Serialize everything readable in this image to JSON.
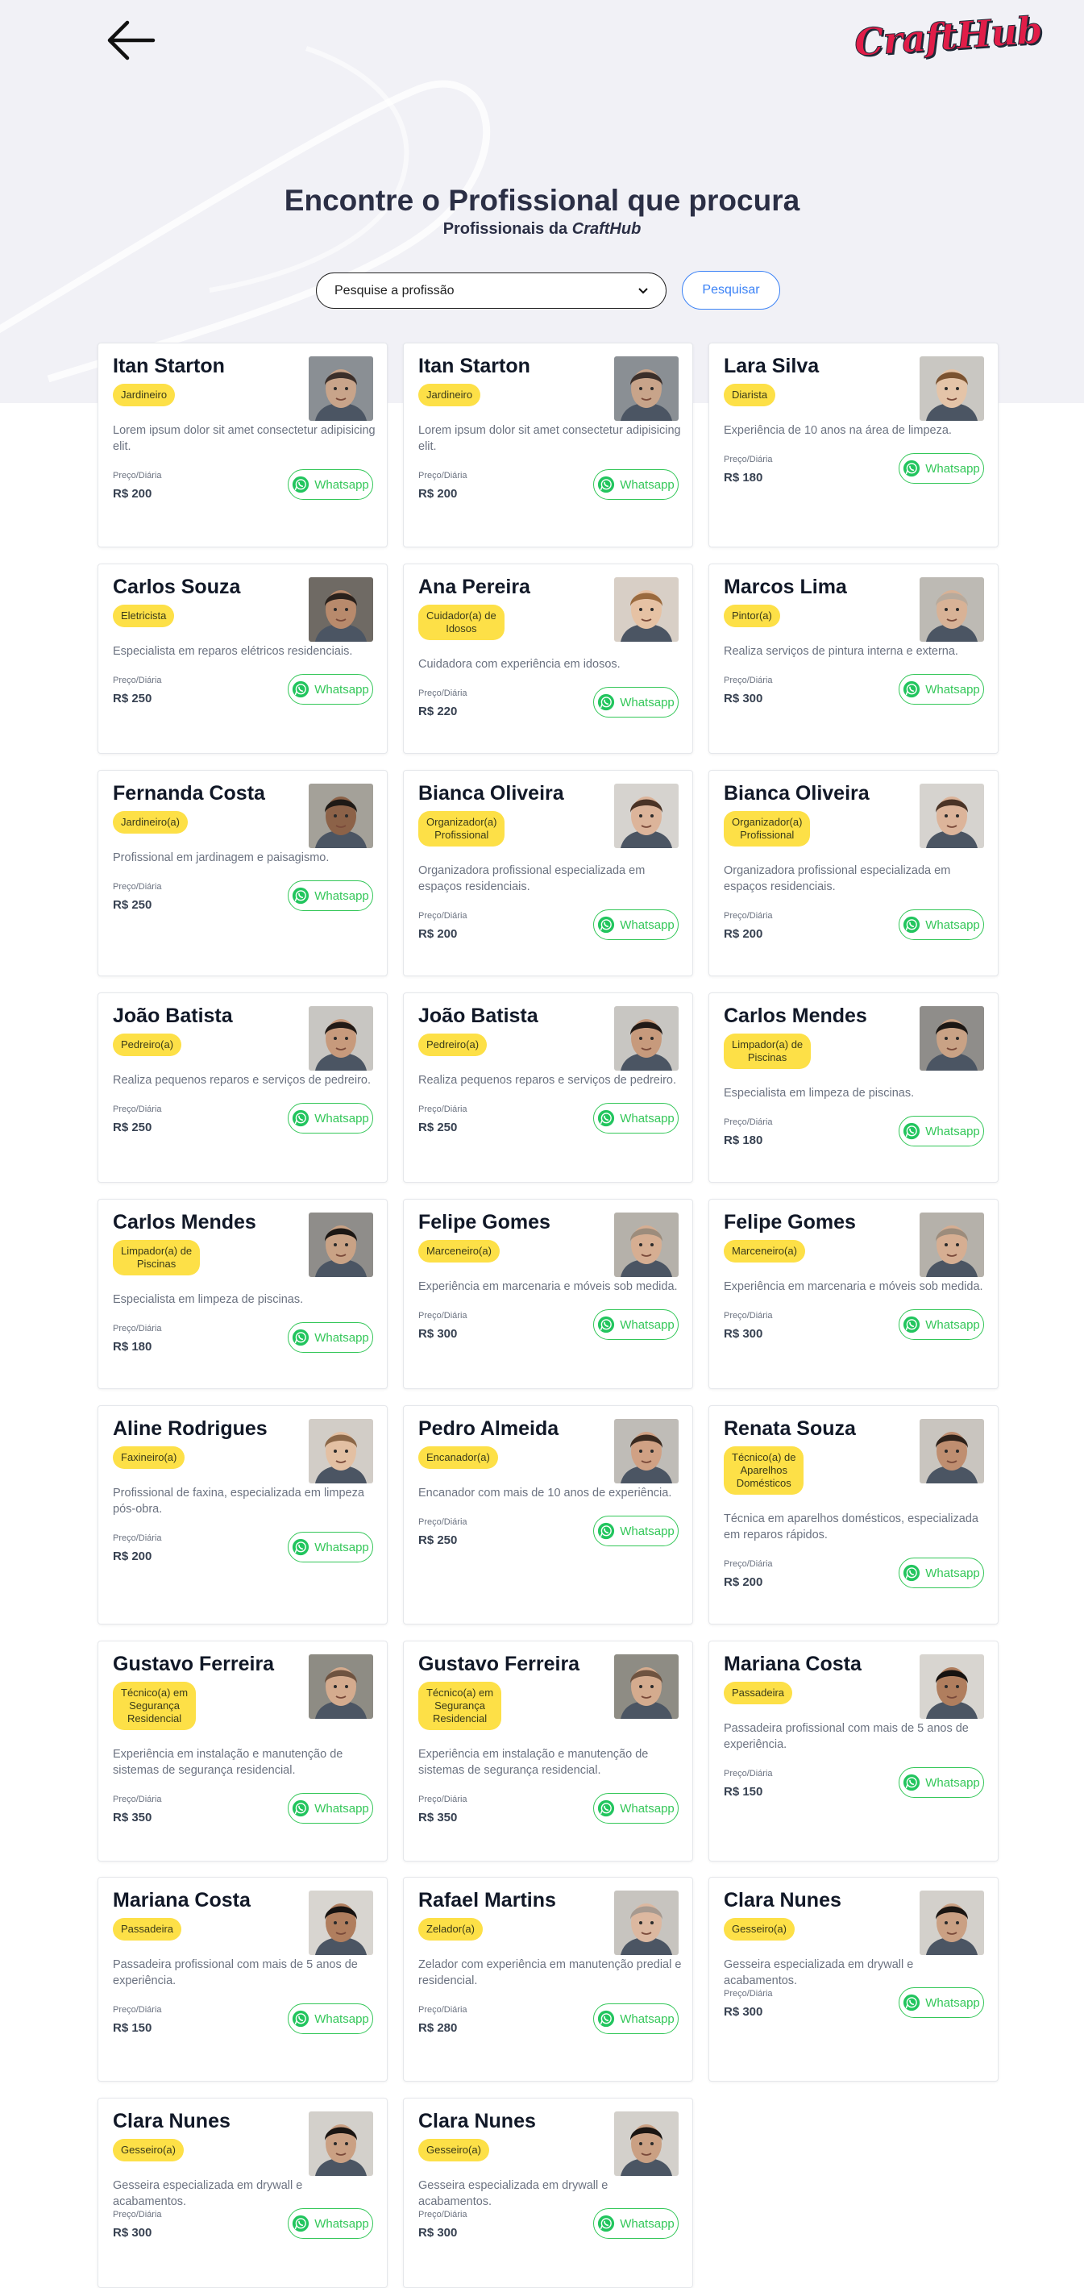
{
  "header": {
    "back_icon": "arrow-left-icon",
    "logo_text": "CraftHub",
    "title": "Encontre o Profissional que procura",
    "subtitle_prefix": "Profissionais da ",
    "subtitle_brand": "CraftHub"
  },
  "search": {
    "selected": "Pesquise a profissão",
    "button_label": "Pesquisar"
  },
  "colors": {
    "hero_bg": "#f1f1f6",
    "badge": "#fde047",
    "whatsapp": "#34c759",
    "accent_blue": "#3b82f6",
    "logo_red": "#e11d48"
  },
  "card_labels": {
    "price_label": "Preço/Diária",
    "whatsapp_label": "Whatsapp"
  },
  "cards": [
    {
      "name": "Itan Starton",
      "badge": [
        "Jardineiro"
      ],
      "desc": [
        "Lorem ipsum dolor sit amet consectetur adipisicing",
        "elit."
      ],
      "price": "R$ 200",
      "skin": "#c8a48a",
      "hair": "#3b2f2a",
      "bg": "#8a8f94"
    },
    {
      "name": "Itan Starton",
      "badge": [
        "Jardineiro"
      ],
      "desc": [
        "Lorem ipsum dolor sit amet consectetur adipisicing",
        "elit."
      ],
      "price": "R$ 200",
      "skin": "#c8a48a",
      "hair": "#3b2f2a",
      "bg": "#8a8f94"
    },
    {
      "name": "Lara Silva",
      "badge": [
        "Diarista"
      ],
      "desc": [
        "Experiência de 10 anos na área de limpeza."
      ],
      "price": "R$ 180",
      "skin": "#e4c4a8",
      "hair": "#7a5230",
      "bg": "#c9c7c2"
    },
    {
      "name": "Carlos Souza",
      "badge": [
        "Eletricista"
      ],
      "desc": [
        "Especialista em reparos elétricos residenciais."
      ],
      "price": "R$ 250",
      "skin": "#b88a6c",
      "hair": "#2a211c",
      "bg": "#6f6a64"
    },
    {
      "name": "Ana Pereira",
      "badge": [
        "Cuidador(a) de",
        "Idosos"
      ],
      "desc": [
        "Cuidadora com experiência em idosos."
      ],
      "price": "R$ 220",
      "skin": "#e6c2a4",
      "hair": "#9a6a3e",
      "bg": "#d8cfc6"
    },
    {
      "name": "Marcos Lima",
      "badge": [
        "Pintor(a)"
      ],
      "desc": [
        "Realiza serviços de pintura interna e externa."
      ],
      "price": "R$ 300",
      "skin": "#d8b296",
      "hair": "#b8aa9c",
      "bg": "#bdbab4"
    },
    {
      "name": "Fernanda Costa",
      "badge": [
        "Jardineiro(a)"
      ],
      "desc": [
        "Profissional em jardinagem e paisagismo."
      ],
      "price": "R$ 250",
      "skin": "#8c6248",
      "hair": "#1f1a16",
      "bg": "#a4a199"
    },
    {
      "name": "Bianca Oliveira",
      "badge": [
        "Organizador(a)",
        "Profissional"
      ],
      "desc": [
        "Organizadora profissional especializada em",
        "espaços residenciais."
      ],
      "price": "R$ 200",
      "skin": "#dcb49a",
      "hair": "#4a3326",
      "bg": "#d6d3cf"
    },
    {
      "name": "Bianca Oliveira",
      "badge": [
        "Organizador(a)",
        "Profissional"
      ],
      "desc": [
        "Organizadora profissional especializada em",
        "espaços residenciais."
      ],
      "price": "R$ 200",
      "skin": "#dcb49a",
      "hair": "#4a3326",
      "bg": "#d6d3cf"
    },
    {
      "name": "João Batista",
      "badge": [
        "Pedreiro(a)"
      ],
      "desc": [
        "Realiza pequenos reparos e serviços de pedreiro."
      ],
      "price": "R$ 250",
      "skin": "#c79a7c",
      "hair": "#221a16",
      "bg": "#c8c6c2"
    },
    {
      "name": "João Batista",
      "badge": [
        "Pedreiro(a)"
      ],
      "desc": [
        "Realiza pequenos reparos e serviços de pedreiro."
      ],
      "price": "R$ 250",
      "skin": "#c79a7c",
      "hair": "#221a16",
      "bg": "#c8c6c2"
    },
    {
      "name": "Carlos Mendes",
      "badge": [
        "Limpador(a) de",
        "Piscinas"
      ],
      "desc": [
        "Especialista em limpeza de piscinas."
      ],
      "price": "R$ 180",
      "skin": "#c9a285",
      "hair": "#1c1714",
      "bg": "#8f8d8a"
    },
    {
      "name": "Carlos Mendes",
      "badge": [
        "Limpador(a) de",
        "Piscinas"
      ],
      "desc": [
        "Especialista em limpeza de piscinas."
      ],
      "price": "R$ 180",
      "skin": "#c9a285",
      "hair": "#1c1714",
      "bg": "#8f8d8a"
    },
    {
      "name": "Felipe Gomes",
      "badge": [
        "Marceneiro(a)"
      ],
      "desc": [
        "Experiência em marcenaria e móveis sob medida."
      ],
      "price": "R$ 300",
      "skin": "#d6ae92",
      "hair": "#9c8c7c",
      "bg": "#b5b1aa"
    },
    {
      "name": "Felipe Gomes",
      "badge": [
        "Marceneiro(a)"
      ],
      "desc": [
        "Experiência em marcenaria e móveis sob medida."
      ],
      "price": "R$ 300",
      "skin": "#d6ae92",
      "hair": "#9c8c7c",
      "bg": "#b5b1aa"
    },
    {
      "name": "Aline Rodrigues",
      "badge": [
        "Faxineiro(a)"
      ],
      "desc": [
        "Profissional de faxina, especializada em limpeza",
        "pós-obra."
      ],
      "price": "R$ 200",
      "skin": "#e3c0a3",
      "hair": "#8b6748",
      "bg": "#d2cdc7"
    },
    {
      "name": "Pedro Almeida",
      "badge": [
        "Encanador(a)"
      ],
      "desc": [
        "Encanador com mais de 10 anos de experiência."
      ],
      "price": "R$ 250",
      "skin": "#d0a184",
      "hair": "#3a2a20",
      "bg": "#bfbcb7"
    },
    {
      "name": "Renata Souza",
      "badge": [
        "Técnico(a) de",
        "Aparelhos",
        "Domésticos"
      ],
      "desc": [
        "Técnica em aparelhos domésticos, especializada",
        "em reparos rápidos."
      ],
      "price": "R$ 200",
      "skin": "#bf8e70",
      "hair": "#2d211a",
      "bg": "#c9c5bf"
    },
    {
      "name": "Gustavo Ferreira",
      "badge": [
        "Técnico(a) em",
        "Segurança",
        "Residencial"
      ],
      "desc": [
        "Experiência em instalação e manutenção de",
        "sistemas de segurança residencial."
      ],
      "price": "R$ 350",
      "skin": "#d4ab8e",
      "hair": "#6e5340",
      "bg": "#8e8c84"
    },
    {
      "name": "Gustavo Ferreira",
      "badge": [
        "Técnico(a) em",
        "Segurança",
        "Residencial"
      ],
      "desc": [
        "Experiência em instalação e manutenção de",
        "sistemas de segurança residencial."
      ],
      "price": "R$ 350",
      "skin": "#d4ab8e",
      "hair": "#6e5340",
      "bg": "#8e8c84"
    },
    {
      "name": "Mariana Costa",
      "badge": [
        "Passadeira"
      ],
      "desc": [
        "Passadeira profissional com mais de 5 anos de",
        "experiência."
      ],
      "price": "R$ 150",
      "skin": "#b07e5e",
      "hair": "#161210",
      "bg": "#d8d5d0"
    },
    {
      "name": "Mariana Costa",
      "badge": [
        "Passadeira"
      ],
      "desc": [
        "Passadeira profissional com mais de 5 anos de",
        "experiência."
      ],
      "price": "R$ 150",
      "skin": "#b07e5e",
      "hair": "#161210",
      "bg": "#d8d5d0"
    },
    {
      "name": "Rafael Martins",
      "badge": [
        "Zelador(a)"
      ],
      "desc": [
        "Zelador com experiência em manutenção predial e",
        "residencial."
      ],
      "price": "R$ 280",
      "skin": "#dcb8a0",
      "hair": "#a79a90",
      "bg": "#c7c4bf"
    },
    {
      "name": "Clara Nunes",
      "badge": [
        "Gesseiro(a)"
      ],
      "desc": [
        "Gesseira especializada em drywall e acabamentos."
      ],
      "price": "R$ 300",
      "skin": "#caa083",
      "hair": "#1a1512",
      "bg": "#d3d0cb"
    },
    {
      "name": "Clara Nunes",
      "badge": [
        "Gesseiro(a)"
      ],
      "desc": [
        "Gesseira especializada em drywall e acabamentos."
      ],
      "price": "R$ 300",
      "skin": "#caa083",
      "hair": "#1a1512",
      "bg": "#d3d0cb"
    },
    {
      "name": "Clara Nunes",
      "badge": [
        "Gesseiro(a)"
      ],
      "desc": [
        "Gesseira especializada em drywall e acabamentos."
      ],
      "price": "R$ 300",
      "skin": "#caa083",
      "hair": "#1a1512",
      "bg": "#d3d0cb"
    }
  ]
}
